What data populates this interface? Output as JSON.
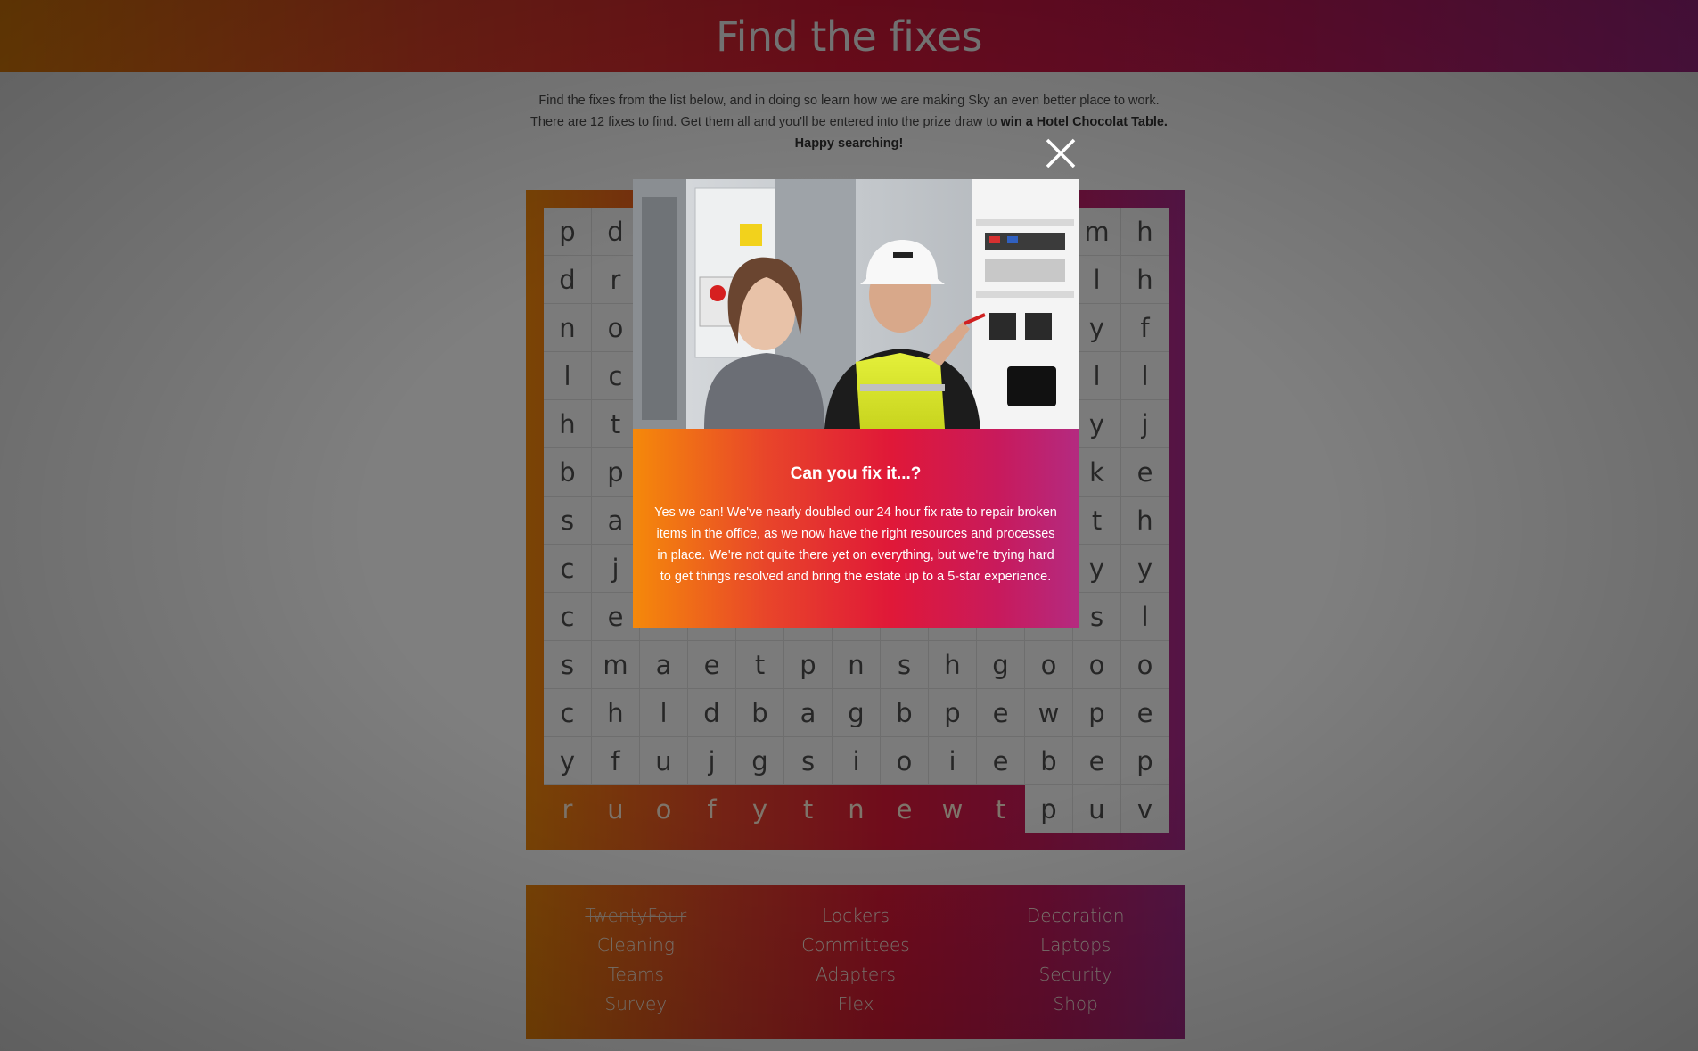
{
  "header": {
    "title": "Find the fixes"
  },
  "intro": {
    "line1": "Find the fixes from the list below, and in doing so learn how we are making Sky an even better place to work.",
    "line2_prefix": "There are 12 fixes to find. Get them all and you'll be entered into the prize draw to ",
    "line2_bold": "win a Hotel Chocolat Table.",
    "line3": "Happy searching!"
  },
  "grid": {
    "rows": [
      "pd#########mh",
      "dr#########lh",
      "no#########yf",
      "lc#########ll",
      "ht#########yj",
      "bp#########ke",
      "sa#########th",
      "cj#########yy",
      "ce#########sl",
      "smaetpnshgooo",
      "chldbagbpewpe",
      "yfujgsioiebep",
      "ruofytnewtpuv"
    ],
    "found_row": 12,
    "found_count": 10
  },
  "words": [
    {
      "label": "TwentyFour",
      "found": true
    },
    {
      "label": "Cleaning",
      "found": false
    },
    {
      "label": "Teams",
      "found": false
    },
    {
      "label": "Survey",
      "found": false
    },
    {
      "label": "Lockers",
      "found": false
    },
    {
      "label": "Committees",
      "found": false
    },
    {
      "label": "Adapters",
      "found": false
    },
    {
      "label": "Flex",
      "found": false
    },
    {
      "label": "Decoration",
      "found": false
    },
    {
      "label": "Laptops",
      "found": false
    },
    {
      "label": "Security",
      "found": false
    },
    {
      "label": "Shop",
      "found": false
    }
  ],
  "modal": {
    "title": "Can you fix it...?",
    "text": "Yes we can! We've nearly doubled our 24 hour fix rate to repair broken items in the office, as we now have the right resources and processes in place. We're not quite there yet on everything, but we're trying hard to get things resolved and bring the estate up to a 5-star experience.",
    "close_icon": "close-icon",
    "photo_icon": "engineer-photo"
  }
}
